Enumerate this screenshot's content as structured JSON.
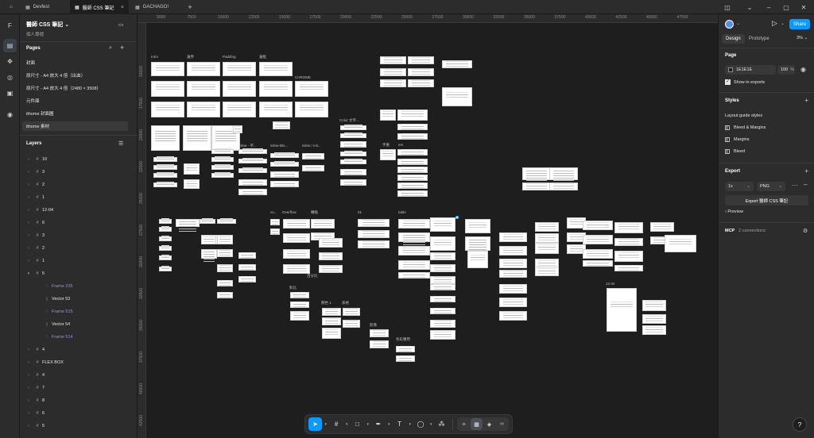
{
  "tabs": [
    {
      "label": "Devfest"
    },
    {
      "label": "醫師 CSS 筆記"
    },
    {
      "label": "GACHAGO!"
    }
  ],
  "file": {
    "title": "醫師 CSS 筆記",
    "owner": "個人專檔"
  },
  "pages": {
    "header": "Pages",
    "items": [
      {
        "label": "封面"
      },
      {
        "label": "原尺寸 - A4 放大 4 倍（出血）"
      },
      {
        "label": "原尺寸 - A4 放大 4 倍（2480 × 3508）"
      },
      {
        "label": "元件庫"
      },
      {
        "label": "ithome 封面圖"
      },
      {
        "label": "ithome 素材"
      }
    ]
  },
  "layers": {
    "header": "Layers",
    "items": [
      {
        "label": "10"
      },
      {
        "label": "3"
      },
      {
        "label": "2"
      },
      {
        "label": "1"
      },
      {
        "label": "12-04"
      },
      {
        "label": "6"
      },
      {
        "label": "3"
      },
      {
        "label": "2"
      },
      {
        "label": "1"
      },
      {
        "label": "5"
      },
      {
        "label": "Frame 235"
      },
      {
        "label": "Vector 53"
      },
      {
        "label": "Frame 515"
      },
      {
        "label": "Vector 54"
      },
      {
        "label": "Frame 514"
      },
      {
        "label": "4"
      },
      {
        "label": "FLEX BOX"
      },
      {
        "label": "4"
      },
      {
        "label": "7"
      },
      {
        "label": "8"
      },
      {
        "label": "6"
      },
      {
        "label": "5"
      }
    ]
  },
  "ruler": {
    "top": [
      "5000",
      "7500",
      "10000",
      "12500",
      "15000",
      "17500",
      "20000",
      "22500",
      "25000",
      "27500",
      "30000",
      "32500",
      "35000",
      "37500",
      "40000",
      "42500",
      "45000",
      "47500"
    ],
    "left": [
      "15000",
      "17500",
      "20000",
      "22500",
      "25000",
      "27500",
      "30000",
      "32500",
      "35000",
      "37500",
      "40000",
      "42500"
    ]
  },
  "canvas_labels": {
    "a": "Intro",
    "b": "邊界",
    "c": "Padding",
    "d": "邊框",
    "e": "CHROME",
    "f": "inline - 字...",
    "g": "inline-Blo...",
    "h": "inline / inli...",
    "i": "Color 文字...",
    "j": "字重",
    "k": "em",
    "l": "co...",
    "m": "Overflow",
    "n": "轉換",
    "o": "01",
    "p": "table",
    "q": "Relati...",
    "r": "百分比",
    "s": "對比",
    "t": "顏色 1",
    "u": "表格",
    "v": "影像",
    "w": "色彩應用",
    "x": "12-04"
  },
  "right": {
    "share": "Share",
    "tab_design": "Design",
    "tab_prototype": "Prototype",
    "zoom": "3%",
    "page_header": "Page",
    "page_color": "1E1E1E",
    "page_opacity": "100",
    "page_pct": "%",
    "show_exports": "Show in exports",
    "styles_header": "Styles",
    "layout_guide": "Layout guide styles",
    "style_items": [
      {
        "label": "Bleed & Margins"
      },
      {
        "label": "Margins"
      },
      {
        "label": "Bleed"
      }
    ],
    "export_header": "Export",
    "export_scale": "1x",
    "export_format": "PNG",
    "export_button": "Export 醫師 CSS 筆記",
    "preview": "Preview",
    "mcp": "MCP",
    "mcp_status": "2 connections",
    "help": "?"
  }
}
